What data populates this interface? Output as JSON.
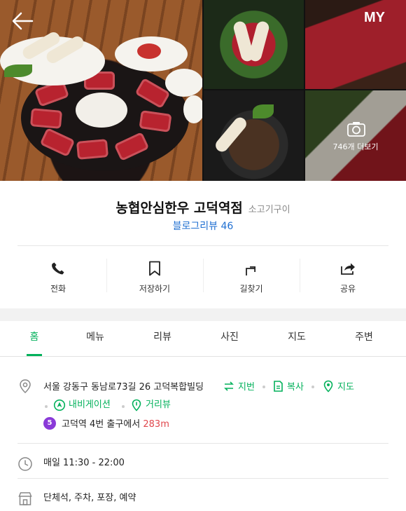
{
  "header": {
    "my_label": "MY",
    "more_photos_label": "746개 더보기"
  },
  "place": {
    "name": "농협안심한우 고덕역점",
    "category": "소고기구이",
    "blog_review_label": "블로그리뷰",
    "blog_review_count": "46"
  },
  "actions": [
    {
      "label": "전화",
      "icon": "phone-icon"
    },
    {
      "label": "저장하기",
      "icon": "bookmark-icon"
    },
    {
      "label": "길찾기",
      "icon": "directions-icon"
    },
    {
      "label": "공유",
      "icon": "share-icon"
    }
  ],
  "tabs": [
    {
      "label": "홈",
      "active": true
    },
    {
      "label": "메뉴"
    },
    {
      "label": "리뷰"
    },
    {
      "label": "사진"
    },
    {
      "label": "지도"
    },
    {
      "label": "주변"
    }
  ],
  "info": {
    "address": "서울 강동구 동남로73길 26 고덕복합빌딩",
    "address_links": {
      "lot_number": "지번",
      "copy": "복사",
      "map": "지도",
      "navigation": "내비게이션",
      "street_view": "거리뷰"
    },
    "subway": {
      "line": "5",
      "station": "고덕역",
      "exit_text": "4번 출구에서",
      "distance": "283m",
      "line_color": "#8a3ad8"
    },
    "hours": "매일 11:30 - 22:00",
    "facilities": "단체석, 주차, 포장, 예약"
  },
  "colors": {
    "accent_green": "#03b15b",
    "link_blue": "#1f6fd1",
    "distance_red": "#e0474c"
  }
}
